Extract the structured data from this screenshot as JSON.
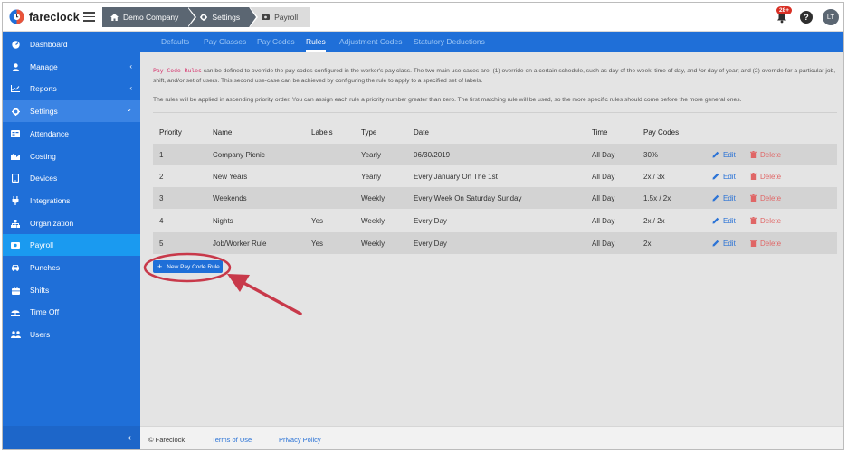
{
  "app": {
    "name": "fareclock",
    "brand_color": "#1f6fd8"
  },
  "breadcrumbs": [
    {
      "label": "Demo Company",
      "icon": "home-icon"
    },
    {
      "label": "Settings",
      "icon": "gear-icon"
    },
    {
      "label": "Payroll",
      "icon": "payroll-icon"
    }
  ],
  "header": {
    "notification_count": "28+",
    "help_label": "?",
    "avatar_initials": "LT"
  },
  "sidebar": {
    "items": [
      {
        "label": "Dashboard",
        "icon": "dashboard-icon"
      },
      {
        "label": "Manage",
        "icon": "user-icon",
        "chevron": "‹"
      },
      {
        "label": "Reports",
        "icon": "chart-icon",
        "chevron": "‹"
      },
      {
        "label": "Settings",
        "icon": "gear-icon",
        "chevron": "⌄"
      },
      {
        "label": "Attendance",
        "icon": "attendance-icon"
      },
      {
        "label": "Costing",
        "icon": "costing-icon"
      },
      {
        "label": "Devices",
        "icon": "tablet-icon"
      },
      {
        "label": "Integrations",
        "icon": "plug-icon"
      },
      {
        "label": "Organization",
        "icon": "org-icon"
      },
      {
        "label": "Payroll",
        "icon": "payroll-icon"
      },
      {
        "label": "Punches",
        "icon": "car-icon"
      },
      {
        "label": "Shifts",
        "icon": "briefcase-icon"
      },
      {
        "label": "Time Off",
        "icon": "umbrella-icon"
      },
      {
        "label": "Users",
        "icon": "users-icon"
      }
    ],
    "collapse_label": "‹"
  },
  "tabs": [
    {
      "label": "Defaults"
    },
    {
      "label": "Pay Classes"
    },
    {
      "label": "Pay Codes"
    },
    {
      "label": "Rules",
      "active": true
    },
    {
      "label": "Adjustment Codes"
    },
    {
      "label": "Statutory Deductions"
    }
  ],
  "description": {
    "code_term": "Pay Code Rules",
    "text1": " can be defined to override the pay codes configured in the worker's pay class. The two main use-cases are: (1) override on a certain schedule, such as day of the week, time of day, and /or day of year; and (2) override for a particular job, shift, and/or set of users. This second use-case can be achieved by configuring the rule to apply to a specified set of labels.",
    "text2": "The rules will be applied in ascending priority order. You can assign each rule a priority number greater than zero. The first matching rule will be used, so the more specific rules should come before the more general ones."
  },
  "table": {
    "headers": {
      "priority": "Priority",
      "name": "Name",
      "labels": "Labels",
      "type": "Type",
      "date": "Date",
      "time": "Time",
      "pay_codes": "Pay Codes"
    },
    "rows": [
      {
        "priority": "1",
        "name": "Company Picnic",
        "labels": "",
        "type": "Yearly",
        "date": "06/30/2019",
        "time": "All Day",
        "pay_codes": "30%"
      },
      {
        "priority": "2",
        "name": "New Years",
        "labels": "",
        "type": "Yearly",
        "date": "Every January On The 1st",
        "time": "All Day",
        "pay_codes": "2x / 3x"
      },
      {
        "priority": "3",
        "name": "Weekends",
        "labels": "",
        "type": "Weekly",
        "date": "Every Week On Saturday Sunday",
        "time": "All Day",
        "pay_codes": "1.5x / 2x"
      },
      {
        "priority": "4",
        "name": "Nights",
        "labels": "Yes",
        "type": "Weekly",
        "date": "Every Day",
        "time": "All Day",
        "pay_codes": "2x / 2x"
      },
      {
        "priority": "5",
        "name": "Job/Worker Rule",
        "labels": "Yes",
        "type": "Weekly",
        "date": "Every Day",
        "time": "All Day",
        "pay_codes": "2x"
      }
    ],
    "edit_label": "Edit",
    "delete_label": "Delete"
  },
  "new_button": {
    "label": "New Pay Code Rule",
    "plus": "+"
  },
  "footer": {
    "copyright": "© Fareclock",
    "terms": "Terms of Use",
    "privacy": "Privacy Policy"
  },
  "annotation": {
    "color": "#c8394a"
  }
}
